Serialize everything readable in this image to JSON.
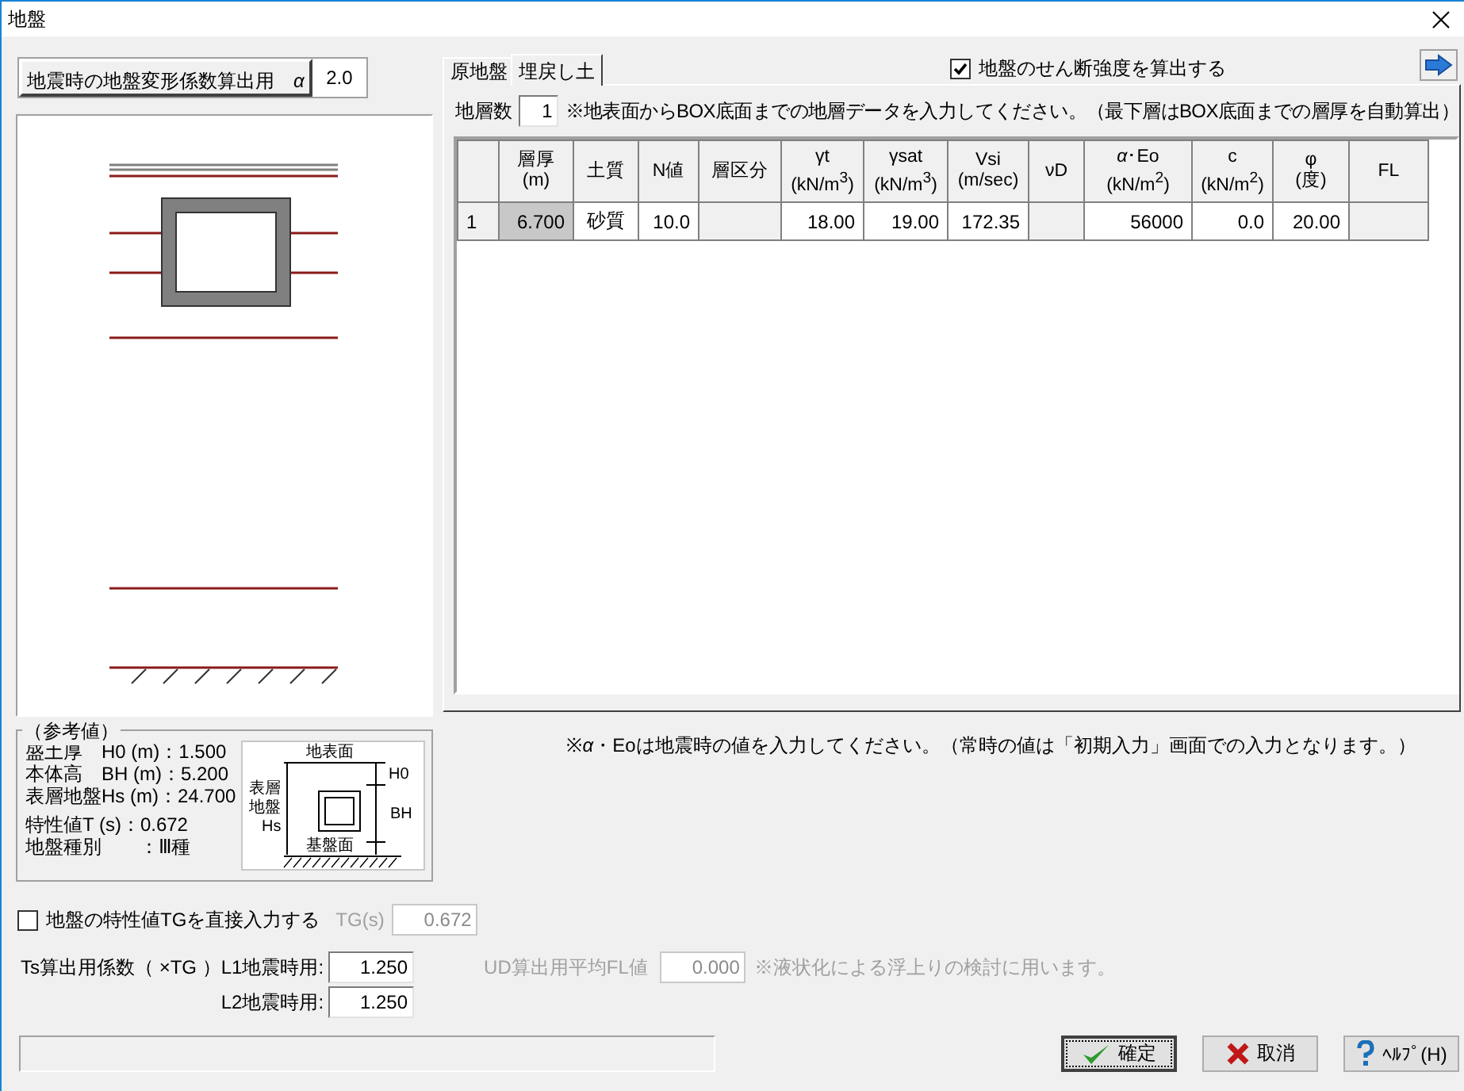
{
  "window": {
    "title": "地盤"
  },
  "alpha": {
    "label": "地震時の地盤変形係数算出用　*α*",
    "value": "2.0"
  },
  "tabs": [
    {
      "label": "原地盤",
      "selected": false
    },
    {
      "label": "埋戻し土",
      "selected": true
    }
  ],
  "shear_check": {
    "label": "地盤のせん断強度を算出する",
    "checked": true
  },
  "layer_count": {
    "label": "地層数",
    "value": "1",
    "note": "※地表面からBOX底面までの地層データを入力してください。（最下層はBOX底面までの層厚を自動算出）"
  },
  "table": {
    "columns": [
      {
        "label": "層厚",
        "unit": "(m)"
      },
      {
        "label": "土質"
      },
      {
        "label": "N値"
      },
      {
        "label": "層区分"
      },
      {
        "label": "γt",
        "unit": "(kN/m$^{3}$)"
      },
      {
        "label": "γsat",
        "unit": "(kN/m$^{3}$)"
      },
      {
        "label": "Vsi",
        "unit": "(m/sec)"
      },
      {
        "label": "νD"
      },
      {
        "label": "*α*･Eo",
        "unit": "(kN/m$^{2}$)"
      },
      {
        "label": "c",
        "unit": "(kN/m$^{2}$)"
      },
      {
        "label": "φ",
        "unit": "(度)"
      },
      {
        "label": "FL"
      }
    ],
    "rows": [
      {
        "number": "1",
        "cells": [
          {
            "kind": "computed",
            "value": "6.700"
          },
          {
            "kind": "text",
            "value": "砂質"
          },
          {
            "kind": "number",
            "value": "10.0"
          },
          {
            "kind": "select"
          },
          {
            "kind": "number",
            "value": "18.00"
          },
          {
            "kind": "number",
            "value": "19.00"
          },
          {
            "kind": "number",
            "value": "172.35"
          },
          {
            "kind": "select"
          },
          {
            "kind": "number",
            "value": "56000"
          },
          {
            "kind": "number",
            "value": "0.0"
          },
          {
            "kind": "number",
            "value": "20.00"
          },
          {
            "kind": "select"
          }
        ]
      }
    ]
  },
  "table_note": "※*α*・Eoは地震時の値を入力してください。（常時の値は「初期入力」画面での入力となります。）",
  "reference": {
    "title": "（参考値）",
    "lines": [
      "盛土厚　H0 (m)：1.500",
      "本体高　BH (m)：5.200",
      "表層地盤Hs (m)：24.700",
      "特性値T (s)：0.672",
      "地盤種別　　：Ⅲ種"
    ],
    "diagram": {
      "surface": "地表面",
      "layer": [
        "表層",
        "地盤",
        "Hs"
      ],
      "h0": "H0",
      "bh": "BH",
      "base": "基盤面"
    }
  },
  "direct_tg": {
    "label": "地盤の特性値TGを直接入力する",
    "checked": false,
    "field_label": "TG(s)",
    "value": "0.672",
    "disabled": true
  },
  "ts": {
    "label": "Ts算出用係数（ ×TG ）",
    "l1_label": "L1地震時用:",
    "l1_value": "1.250",
    "l2_label": "L2地震時用:",
    "l2_value": "1.250"
  },
  "ud": {
    "label": "UD算出用平均FL値",
    "value": "0.000",
    "note": "※液状化による浮上りの検討に用います。",
    "disabled": true
  },
  "buttons": [
    {
      "label": "確定",
      "kind": "ok"
    },
    {
      "label": "取消",
      "kind": "cancel"
    },
    {
      "label": "ﾍﾙﾌﾟ(H)",
      "kind": "help"
    }
  ]
}
